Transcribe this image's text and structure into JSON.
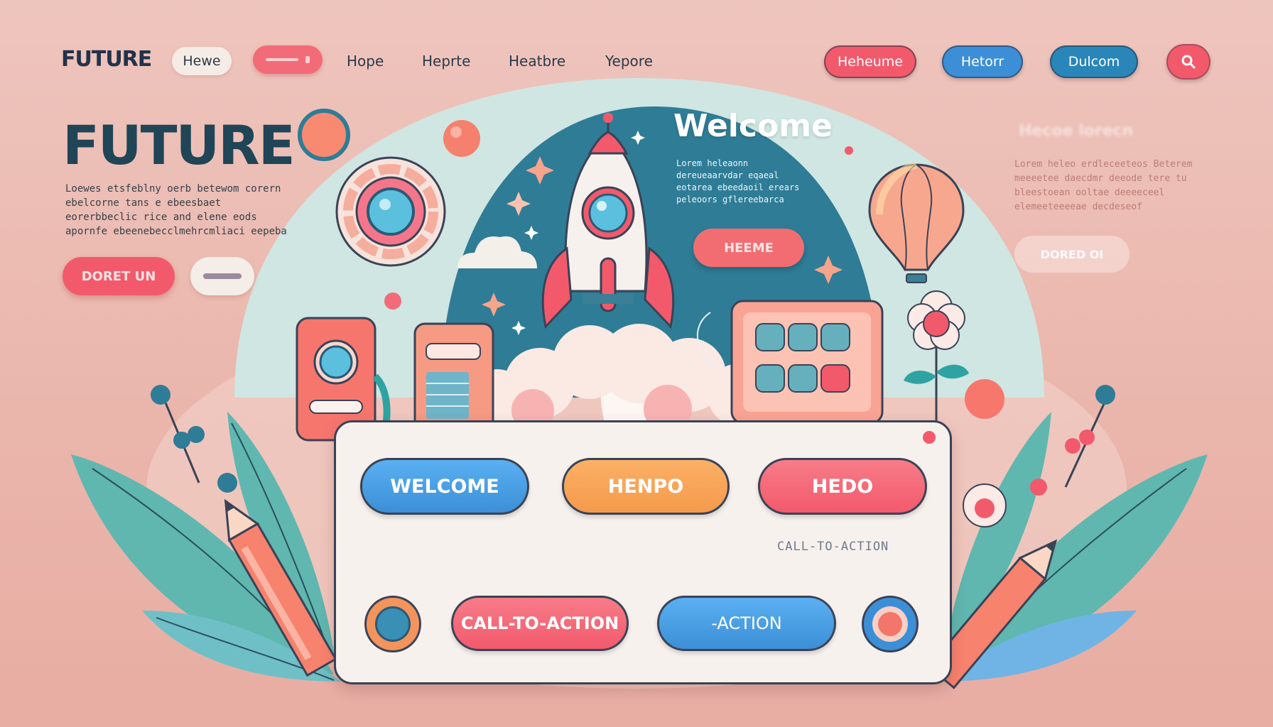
{
  "nav": {
    "brand": "FUTURE",
    "items": [
      "Hewe",
      "",
      "Hope",
      "Heprte",
      "Heatbre",
      "Yepore"
    ],
    "right_buttons": [
      "Heheume",
      "Hetorr",
      "Dulcom"
    ]
  },
  "hero": {
    "title": "FUTURE",
    "text": "Loewes etsfeblny oerb betewom corern ebelcorne tans e ebeesbaet eorerbbeclic rice and elene eods apornfe ebeenebecclmehrcmliaci eepeba",
    "primary_cta": "DORET UN",
    "secondary_cta": ""
  },
  "scene": {
    "welcome_title": "Welcome",
    "welcome_text": "Lorem heleaonn dereueaarvdar eqaeal eotarea ebeedaoil erears peleoors gflereebarca",
    "welcome_button": "HEEME"
  },
  "ghost": {
    "title": "Hecoe lorecn",
    "text": "Lorem heleo erdleceeteos Beterem meeeetee daecdmr deeode tere tu bleestoean ooltae deeeeceel elemeeteeeeae decdeseof",
    "button": "DORED OI"
  },
  "panel": {
    "buttons_top": [
      "WELCOME",
      "HENPO",
      "HEDO"
    ],
    "caption": "CALL-TO-ACTION",
    "buttons_bottom": [
      "CALL-TO-ACTION",
      "-ACTION"
    ]
  },
  "colors": {
    "background": "#eec5bd",
    "primary_red": "#f25a6c",
    "blue": "#3c8fd6",
    "orange": "#f59a4c",
    "teal": "#5fb7b0",
    "navy": "#1f4556"
  }
}
